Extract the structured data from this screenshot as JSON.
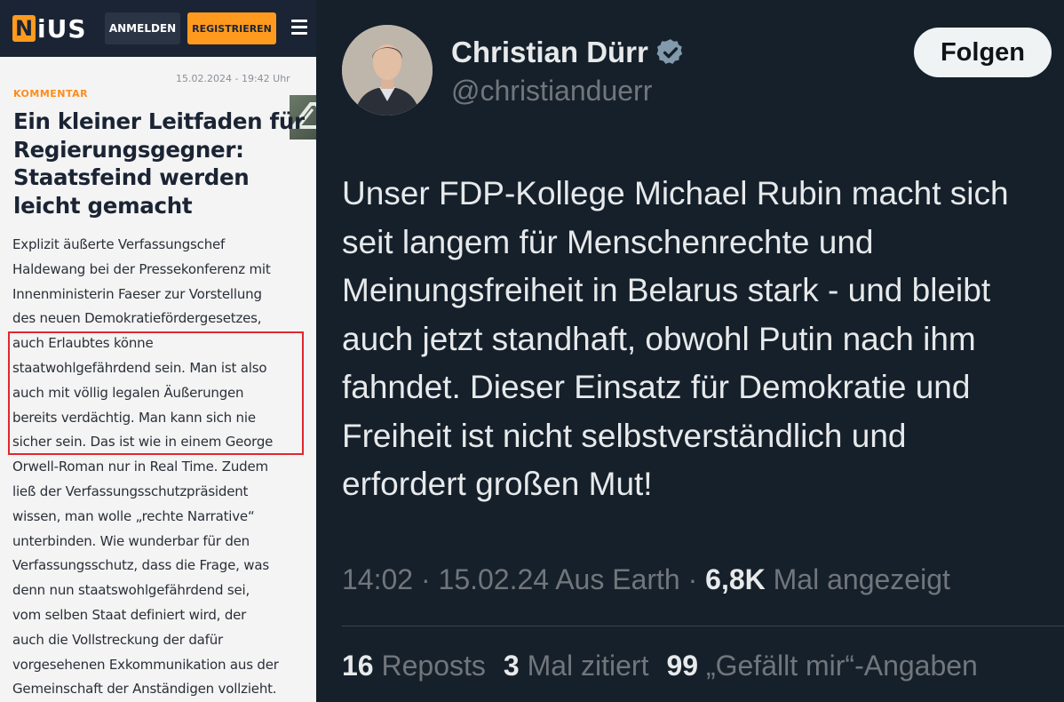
{
  "nius": {
    "logo": {
      "letter": "N",
      "rest": "iUS"
    },
    "login_label": "ANMELDEN",
    "register_label": "REGISTRIEREN",
    "date": "15.02.2024 - 19:42 Uhr",
    "kicker": "KOMMENTAR",
    "headline": "Ein kleiner Leitfaden für Regierungsgegner: Staatsfeind werden leicht gemacht",
    "body_lines": [
      "Explizit äußerte Verfassungschef",
      "Haldewang bei der Pressekonferenz mit",
      "Innenministerin Faeser zur Vorstellung",
      "des neuen Demokratiefördergesetzes,",
      "auch Erlaubtes könne",
      "staatwohlgefährdend sein. Man ist also",
      "auch mit völlig legalen Äußerungen",
      "bereits verdächtig. Man kann sich nie",
      "sicher sein. Das ist wie in einem George",
      "Orwell-Roman nur in Real Time. Zudem",
      "ließ der Verfassungsschutzpräsident",
      "wissen, man wolle „rechte Narrative“",
      "unterbinden. Wie wunderbar für den",
      "Verfassungsschutz, dass die Frage, was",
      "denn nun staatswohlgefährdend sei,",
      "vom selben Staat definiert wird, der",
      "auch die Vollstreckung der dafür",
      "vorgesehenen Exkommunikation aus der",
      "Gemeinschaft der Anständigen vollzieht."
    ],
    "colors": {
      "bar": "#1b2434",
      "accent": "#ff9a1f",
      "highlight": "#e0282d"
    }
  },
  "tweet": {
    "name": "Christian Dürr",
    "handle": "@christianduerr",
    "follow_label": "Folgen",
    "text_lines": [
      "Unser FDP-Kollege Michael Rubin macht sich",
      "seit langem für Menschenrechte und",
      "Meinungsfreiheit in Belarus stark - und bleibt",
      "auch jetzt standhaft, obwohl Putin nach ihm",
      "fahndet. Dieser Einsatz für Demokratie und",
      "Freiheit ist nicht selbstverständlich und",
      "erfordert großen Mut!"
    ],
    "meta": {
      "time": "14:02 · 15.02.24 Aus Earth ·",
      "views_count": "6,8K",
      "views_label": "Mal angezeigt"
    },
    "stats": {
      "reposts_count": "16",
      "reposts_label": "Reposts",
      "quotes_count": "3",
      "quotes_label": "Mal zitiert",
      "likes_count": "99",
      "likes_label": "„Gefällt mir“-Angaben"
    },
    "colors": {
      "background": "#15202b",
      "text": "#e7e9ea",
      "muted": "#71767b",
      "verified": "#829aab"
    }
  }
}
